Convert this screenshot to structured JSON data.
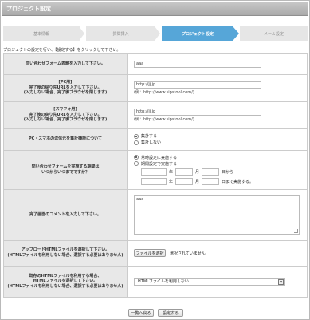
{
  "window": {
    "title": "プロジェクト設定"
  },
  "steps": [
    {
      "label": "基本情報",
      "active": false
    },
    {
      "label": "質問挿入",
      "active": false
    },
    {
      "label": "プロジェクト設定",
      "active": true
    },
    {
      "label": "メール設定",
      "active": false
    }
  ],
  "instruction": "プロジェクトの設定を行い、【設定する】をクリックして下さい。",
  "rows": {
    "form_title": {
      "label": "問い合わせフォーム表題を入力して下さい。",
      "value": "aaa"
    },
    "pc_image": {
      "label": [
        "[PC用]",
        "完了後の戻り先URLを入力して下さい。",
        "(入力しない場合、完了後ブラウザを閉じます)"
      ],
      "value": "http://jj.jp",
      "hint": "(例：http://www.sipstool.com/)"
    },
    "sp_image": {
      "label": [
        "[スマフォ用]",
        "完了後の戻り先URLを入力して下さい。",
        "(入力しない場合、完了後ブラウザを閉じます)"
      ],
      "value": "http://jj.jp",
      "hint": "(例：http://www.sipstool.com/)"
    },
    "aggregate": {
      "label": "PC・スマホの送信元を集計機能について",
      "options": [
        "集計する",
        "集計しない"
      ],
      "selected": 0
    },
    "period": {
      "label": [
        "問い合わせフォームを実施する期間は",
        "いつからいつまでですか？"
      ],
      "options": [
        "常時設定に実施する",
        "期間設定で実施する"
      ],
      "selected": 0,
      "date_units": {
        "year": "年",
        "month": "月",
        "day": "日から",
        "day_end": "日まで実施する。"
      }
    },
    "complete_comment": {
      "label": "完了画面のコメントを入力して下さい。",
      "value": "aaa"
    },
    "upload_html": {
      "label": [
        "アップロードHTMLファイルを選択して下さい。",
        "(HTMLファイルを利用しない場合、選択する必要はありません)"
      ],
      "button": "ファイルを選択",
      "status": "選択されていません"
    },
    "use_html": {
      "label": [
        "既存のHTMLファイルを利用する場合、",
        "HTMLファイルを選択して下さい。",
        "(HTMLファイルを利用しない場合、選択する必要はありません)"
      ],
      "selected": "HTMLファイルを利用しない"
    }
  },
  "buttons": {
    "back": "一覧へ戻る",
    "submit": "設定する"
  },
  "colors": {
    "active_step": "#56a6d8",
    "label_bg": "#e8e8e8",
    "titlebar": "#b3b3b3"
  },
  "icons": {
    "dropdown": "chevron-down-icon"
  }
}
